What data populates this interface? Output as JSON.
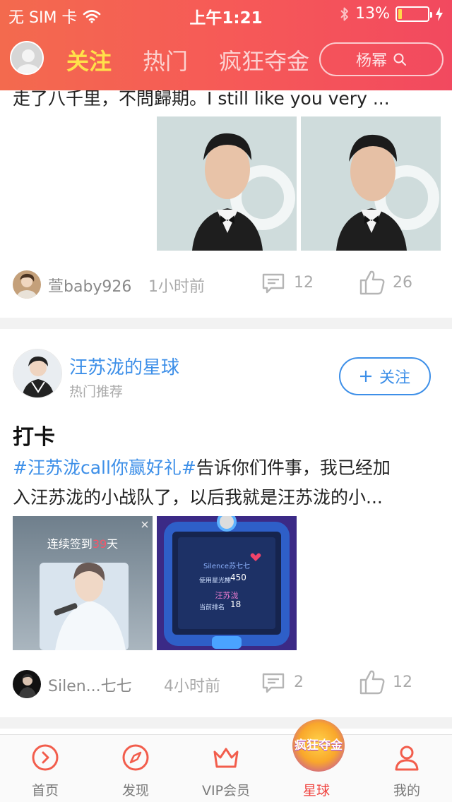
{
  "status_bar": {
    "carrier": "无 SIM 卡",
    "time": "上午1:21",
    "battery_percent": "13%",
    "battery_level": 0.13,
    "battery_color": "#ffd84a"
  },
  "header": {
    "tabs": [
      {
        "label": "关注",
        "active": true
      },
      {
        "label": "热门",
        "active": false
      },
      {
        "label": "疯狂夺金",
        "active": false
      }
    ],
    "search_placeholder": "杨幂",
    "gradient_start": "#f36a4e",
    "gradient_end": "#f2495f",
    "active_tab_color": "#ffe14a"
  },
  "feed": {
    "posts": [
      {
        "text": "走了八千里，不問歸期。I still like you very ...",
        "images": [
          "portrait-photo",
          "portrait-photo"
        ],
        "author": "萱baby926",
        "time": "1小时前",
        "comments": "12",
        "likes": "26"
      },
      {
        "channel_name": "汪苏泷的星球",
        "channel_sub": "热门推荐",
        "follow_label": "关注",
        "title": "打卡",
        "hashtag": "#汪苏泷call你赢好礼#",
        "body_line1_rest": "告诉你们件事，我已经加",
        "body_line2": "入汪苏泷的小战队了，以后我就是汪苏泷的小...",
        "image1": {
          "prefix": "连续签到",
          "days": "39",
          "suffix": "天"
        },
        "image2": {
          "user": "Silence苏七七",
          "row1_label": "使用星光棒",
          "row1_value": "450",
          "name": "汪苏泷",
          "row2_label": "当前排名",
          "row2_value": "18"
        },
        "author": "Silen...七七",
        "time": "4小时前",
        "comments": "2",
        "likes": "12"
      }
    ],
    "link_color": "#3d8fe8"
  },
  "tabbar": {
    "items": [
      {
        "label": "首页",
        "icon": "play-circle-icon"
      },
      {
        "label": "发现",
        "icon": "compass-icon"
      },
      {
        "label": "VIP会员",
        "icon": "crown-icon"
      },
      {
        "label": "星球",
        "icon": "crazy-gold-badge-icon",
        "badge_text": "疯狂夺金",
        "active": true
      },
      {
        "label": "我的",
        "icon": "person-icon"
      }
    ],
    "active_color": "#f0433f"
  }
}
